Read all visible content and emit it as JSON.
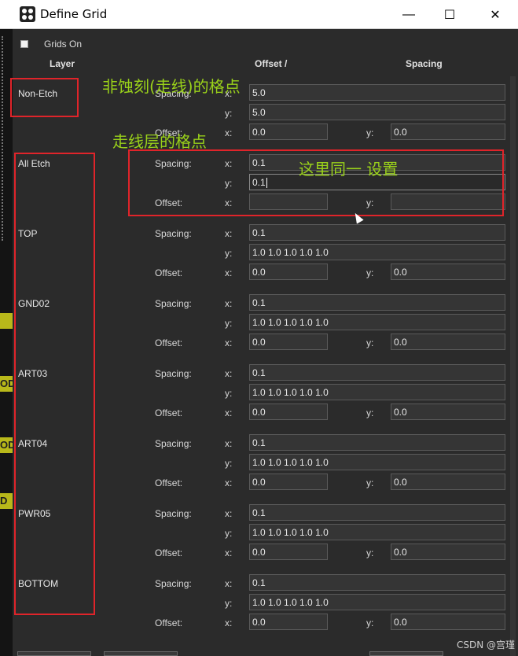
{
  "window": {
    "title": "Define Grid",
    "minimize": "—",
    "maximize": "☐",
    "close": "✕"
  },
  "grids_on": {
    "label": "Grids On",
    "checked": true
  },
  "headers": {
    "layer": "Layer",
    "offset": "Offset   /",
    "spacing": "Spacing"
  },
  "labels": {
    "spacing": "Spacing:",
    "offset": "Offset:",
    "x": "x:",
    "y": "y:"
  },
  "rows": [
    {
      "name": "Non-Etch",
      "spacing_x": "5.0",
      "spacing_y": "5.0",
      "offset_x": "0.0",
      "offset_y": "0.0"
    },
    {
      "name": "All Etch",
      "spacing_x": "0.1",
      "spacing_y": "0.1",
      "offset_x": "",
      "offset_y": ""
    },
    {
      "name": "TOP",
      "spacing_x": "0.1",
      "spacing_y": "1.0 1.0 1.0 1.0 1.0",
      "offset_x": "0.0",
      "offset_y": "0.0"
    },
    {
      "name": "GND02",
      "spacing_x": "0.1",
      "spacing_y": "1.0 1.0 1.0 1.0 1.0",
      "offset_x": "0.0",
      "offset_y": "0.0"
    },
    {
      "name": "ART03",
      "spacing_x": "0.1",
      "spacing_y": "1.0 1.0 1.0 1.0 1.0",
      "offset_x": "0.0",
      "offset_y": "0.0"
    },
    {
      "name": "ART04",
      "spacing_x": "0.1",
      "spacing_y": "1.0 1.0 1.0 1.0 1.0",
      "offset_x": "0.0",
      "offset_y": "0.0"
    },
    {
      "name": "PWR05",
      "spacing_x": "0.1",
      "spacing_y": "1.0 1.0 1.0 1.0 1.0",
      "offset_x": "0.0",
      "offset_y": "0.0"
    },
    {
      "name": "BOTTOM",
      "spacing_x": "0.1",
      "spacing_y": "1.0 1.0 1.0 1.0 1.0",
      "offset_x": "0.0",
      "offset_y": "0.0"
    }
  ],
  "annotations": {
    "non_etch": "非蚀刻(走线)的格点",
    "etch_layers": "走线层的格点",
    "same_setting": "这里同一 设置"
  },
  "background_chips": [
    "OD",
    "OD",
    "D"
  ],
  "watermark": "CSDN @宫瑾",
  "colors": {
    "annotation_red": "#e0242a",
    "annotation_green": "#9ad21a",
    "dialog_bg": "#2b2b2b"
  }
}
